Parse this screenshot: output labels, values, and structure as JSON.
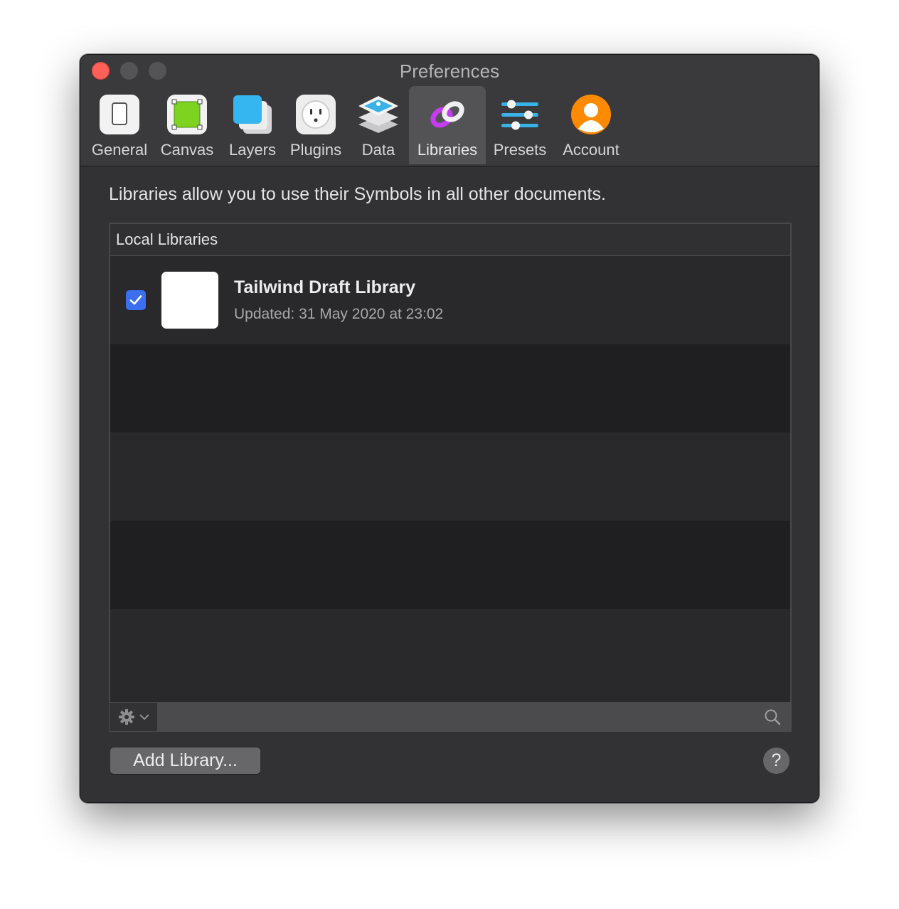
{
  "window": {
    "title": "Preferences"
  },
  "tabs": [
    {
      "label": "General",
      "icon": "general-icon"
    },
    {
      "label": "Canvas",
      "icon": "canvas-icon"
    },
    {
      "label": "Layers",
      "icon": "layers-icon"
    },
    {
      "label": "Plugins",
      "icon": "plugins-icon"
    },
    {
      "label": "Data",
      "icon": "data-icon"
    },
    {
      "label": "Libraries",
      "icon": "libraries-icon",
      "selected": true
    },
    {
      "label": "Presets",
      "icon": "presets-icon"
    },
    {
      "label": "Account",
      "icon": "account-icon"
    }
  ],
  "libraries": {
    "description": "Libraries allow you to use their Symbols in all other documents.",
    "section_header": "Local Libraries",
    "items": [
      {
        "name": "Tailwind Draft Library",
        "updated": "Updated: 31 May 2020 at 23:02",
        "enabled": true
      }
    ]
  },
  "footer": {
    "add_button": "Add Library...",
    "help_button": "?"
  },
  "colors": {
    "window_bg": "#323234",
    "accent_blue": "#3b6ff0",
    "close_red": "#fe5f57",
    "canvas_green": "#7ed321",
    "account_orange": "#ff8a00",
    "libraries_purple": "#c33cf0"
  }
}
